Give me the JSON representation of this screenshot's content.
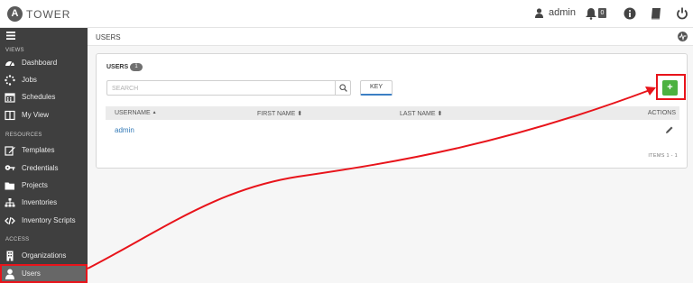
{
  "header": {
    "logo_letter": "A",
    "app_name": "TOWER",
    "user_name": "admin",
    "notification_count": "0",
    "icons": [
      "user-icon",
      "bell-icon",
      "info-icon",
      "book-icon",
      "power-icon"
    ]
  },
  "sidebar": {
    "menu_icon": "hamburger-icon",
    "section_views": "VIEWS",
    "section_resources": "RESOURCES",
    "section_access": "ACCESS",
    "items": [
      {
        "label": "Dashboard",
        "icon": "dashboard-icon"
      },
      {
        "label": "Jobs",
        "icon": "spinner-icon"
      },
      {
        "label": "Schedules",
        "icon": "calendar-icon"
      },
      {
        "label": "My View",
        "icon": "columns-icon"
      },
      {
        "label": "Templates",
        "icon": "pencil-square-icon"
      },
      {
        "label": "Credentials",
        "icon": "key-icon"
      },
      {
        "label": "Projects",
        "icon": "folder-icon"
      },
      {
        "label": "Inventories",
        "icon": "sitemap-icon"
      },
      {
        "label": "Inventory Scripts",
        "icon": "code-icon"
      },
      {
        "label": "Organizations",
        "icon": "building-icon"
      },
      {
        "label": "Users",
        "icon": "user-icon"
      }
    ],
    "active_item": "Users"
  },
  "breadcrumb": "USERS",
  "panel": {
    "title": "USERS",
    "count": "1",
    "search_placeholder": "SEARCH",
    "key_label": "KEY",
    "add_label": "+",
    "columns": [
      "USERNAME",
      "FIRST NAME",
      "LAST NAME",
      "ACTIONS"
    ],
    "sort_glyphs": {
      "username": "▲",
      "first_name": "⬍",
      "last_name": "⬍"
    },
    "rows": [
      {
        "username": "admin",
        "first_name": "",
        "last_name": ""
      }
    ],
    "items_count": "ITEMS  1 - 1"
  },
  "colors": {
    "sidebar_bg": "#3f3f3f",
    "sidebar_active": "#676767",
    "link": "#337ab7",
    "add_button": "#4cb140",
    "annotation": "#e8141b"
  }
}
